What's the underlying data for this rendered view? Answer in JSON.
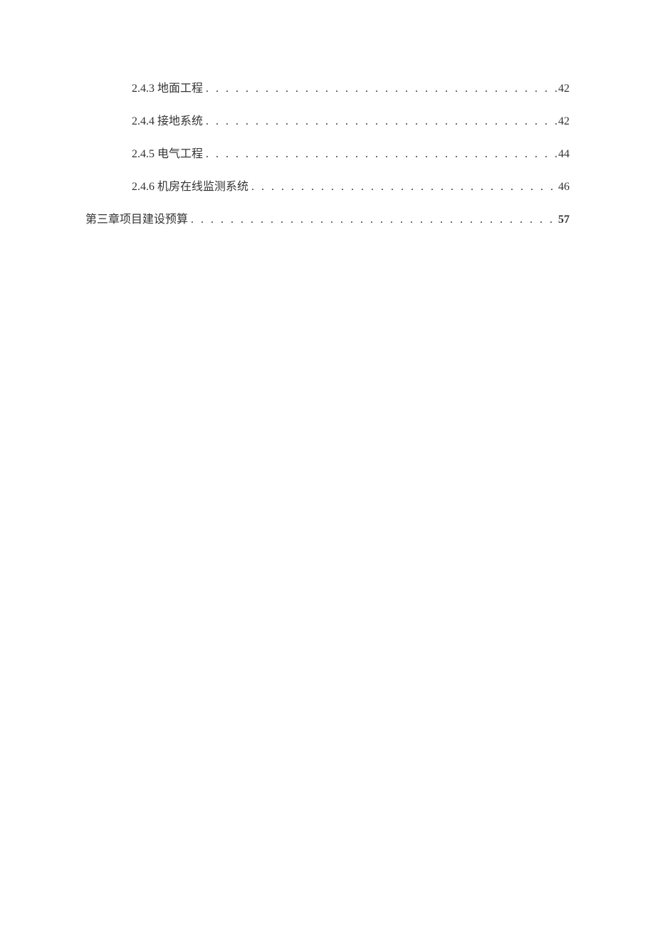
{
  "toc": {
    "items": [
      {
        "label": "2.4.3 地面工程",
        "page": "42",
        "indent": true,
        "bold": false
      },
      {
        "label": "2.4.4 接地系统",
        "page": "42",
        "indent": true,
        "bold": false
      },
      {
        "label": "2.4.5 电气工程",
        "page": "44",
        "indent": true,
        "bold": false
      },
      {
        "label": "2.4.6 机房在线监测系统",
        "page": "46",
        "indent": true,
        "bold": false
      },
      {
        "label": "第三章项目建设预算",
        "page": "57",
        "indent": false,
        "bold": true
      }
    ]
  }
}
